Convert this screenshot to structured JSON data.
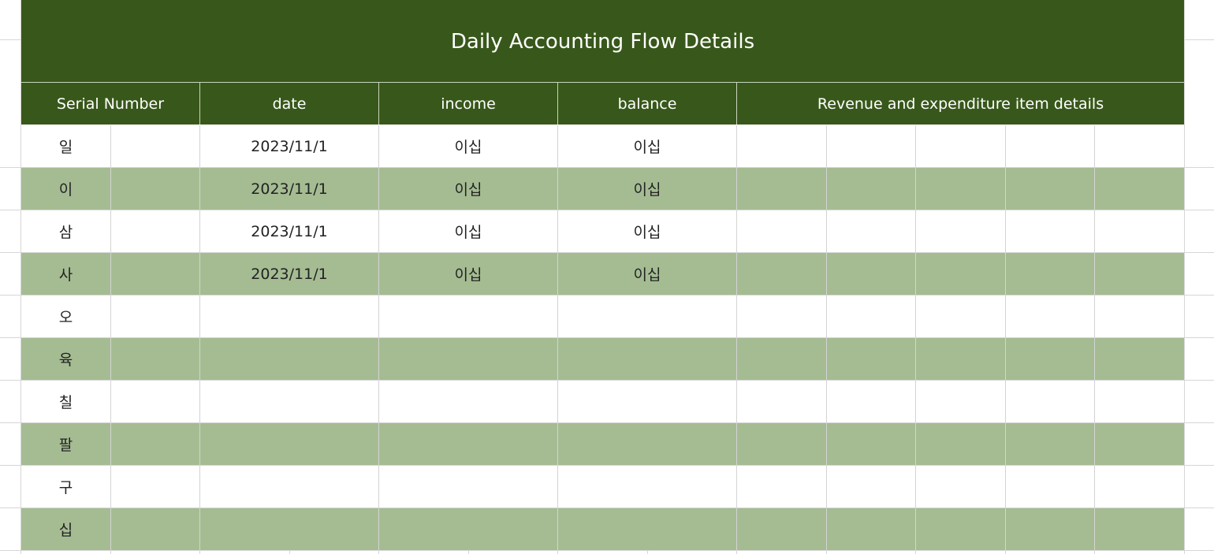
{
  "sheet": {
    "title": "Daily Accounting Flow Details",
    "headers": {
      "serial": "Serial Number",
      "date": "date",
      "income": "income",
      "balance": "balance",
      "details": "Revenue and expenditure item details"
    },
    "colors": {
      "header_green": "#38581b",
      "alt_row_green": "#a5bc93",
      "gridline": "#d6d6d6"
    },
    "rows": [
      {
        "serial": "일",
        "date": "2023/11/1",
        "income": "이십",
        "balance": "이십"
      },
      {
        "serial": "이",
        "date": "2023/11/1",
        "income": "이십",
        "balance": "이십"
      },
      {
        "serial": "삼",
        "date": "2023/11/1",
        "income": "이십",
        "balance": "이십"
      },
      {
        "serial": "사",
        "date": "2023/11/1",
        "income": "이십",
        "balance": "이십"
      },
      {
        "serial": "오",
        "date": "",
        "income": "",
        "balance": ""
      },
      {
        "serial": "육",
        "date": "",
        "income": "",
        "balance": ""
      },
      {
        "serial": "칠",
        "date": "",
        "income": "",
        "balance": ""
      },
      {
        "serial": "팔",
        "date": "",
        "income": "",
        "balance": ""
      },
      {
        "serial": "구",
        "date": "",
        "income": "",
        "balance": ""
      },
      {
        "serial": "십",
        "date": "",
        "income": "",
        "balance": ""
      }
    ]
  }
}
